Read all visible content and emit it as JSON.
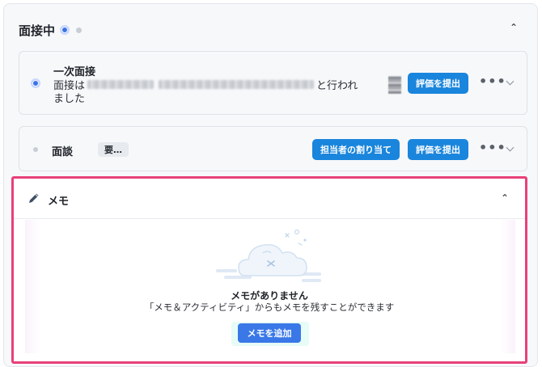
{
  "section": {
    "title": "面接中",
    "collapse_icon": "chevron-up-icon"
  },
  "stages": [
    {
      "name": "一次面接",
      "detail_prefix": "面接は",
      "detail_suffix": "と行われ",
      "detail_line2": "ました",
      "action_label": "評価を提出"
    },
    {
      "name": "面談",
      "tag": "要…",
      "assign_label": "担当者の割り当て",
      "action_label": "評価を提出"
    }
  ],
  "more_label": "•••",
  "memo": {
    "title": "メモ",
    "empty_title": "メモがありません",
    "empty_subtitle": "「メモ＆アクティビティ」からもメモを残すことができます",
    "add_label": "メモを追加"
  },
  "colors": {
    "primary": "#1a85dc",
    "highlight_border": "#e8407a",
    "add_button": "#3a78e8"
  }
}
